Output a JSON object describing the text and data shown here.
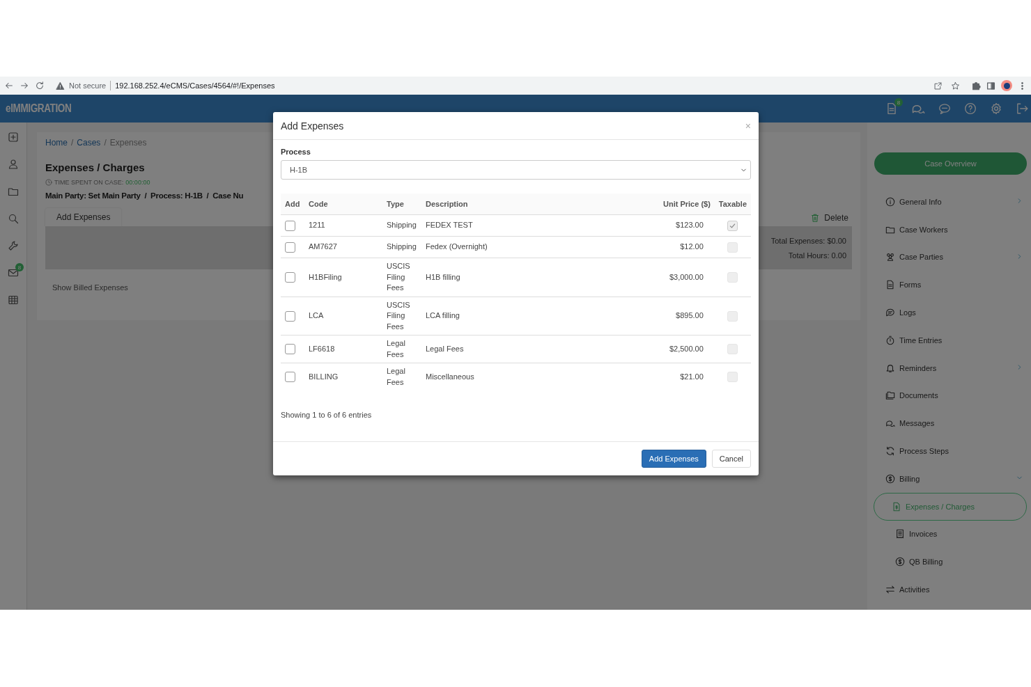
{
  "browser": {
    "security": "Not secure",
    "url": "192.168.252.4/eCMS/Cases/4564/#!/Expenses"
  },
  "header": {
    "logo": "eIMMIGRATION",
    "notification_badge": "8"
  },
  "rail": {
    "mail_badge": "8"
  },
  "breadcrumb": {
    "separator": "/",
    "items": [
      "Home",
      "Cases",
      "Expenses"
    ]
  },
  "page": {
    "title": "Expenses / Charges",
    "time_label": "TIME SPENT ON CASE:",
    "time_value": "00:00:00",
    "info": "Main Party: Set Main Party  /  Process: H-1B  /  Case Nu",
    "tab": "Add Expenses",
    "delete": "Delete",
    "total_expenses": "Total Expenses: $0.00",
    "total_hours": "Total Hours: 0.00",
    "show_billed": "Show Billed Expenses"
  },
  "sidebar": {
    "overview_button": "Case Overview",
    "items": [
      {
        "label": "General Info",
        "kind": "group",
        "expanded": false
      },
      {
        "label": "Case Workers",
        "kind": "link"
      },
      {
        "label": "Case Parties",
        "kind": "group",
        "expanded": false
      },
      {
        "label": "Forms",
        "kind": "link"
      },
      {
        "label": "Logs",
        "kind": "link"
      },
      {
        "label": "Time Entries",
        "kind": "link"
      },
      {
        "label": "Reminders",
        "kind": "group",
        "expanded": false
      },
      {
        "label": "Documents",
        "kind": "link"
      },
      {
        "label": "Messages",
        "kind": "link"
      },
      {
        "label": "Process Steps",
        "kind": "link"
      },
      {
        "label": "Billing",
        "kind": "group",
        "expanded": true,
        "children": [
          {
            "label": "Expenses / Charges",
            "selected": true
          },
          {
            "label": "Invoices",
            "selected": false
          },
          {
            "label": "QB Billing",
            "selected": false
          }
        ]
      },
      {
        "label": "Activities",
        "kind": "link"
      }
    ]
  },
  "modal": {
    "title": "Add Expenses",
    "close": "×",
    "process_label": "Process",
    "process_value": "H-1B",
    "columns": [
      "Add",
      "Code",
      "Type",
      "Description",
      "Unit Price ($)",
      "Taxable"
    ],
    "rows": [
      {
        "add": false,
        "code": "1211",
        "type": "Shipping",
        "description": "FEDEX TEST",
        "price": "$123.00",
        "taxable": true
      },
      {
        "add": false,
        "code": "AM7627",
        "type": "Shipping",
        "description": "Fedex (Overnight)",
        "price": "$12.00",
        "taxable": false
      },
      {
        "add": false,
        "code": "H1BFiling",
        "type": "USCIS Filing Fees",
        "description": "H1B filling",
        "price": "$3,000.00",
        "taxable": false
      },
      {
        "add": false,
        "code": "LCA",
        "type": "USCIS Filing Fees",
        "description": "LCA filling",
        "price": "$895.00",
        "taxable": false
      },
      {
        "add": false,
        "code": "LF6618",
        "type": "Legal Fees",
        "description": "Legal Fees",
        "price": "$2,500.00",
        "taxable": false
      },
      {
        "add": false,
        "code": "BILLING",
        "type": "Legal Fees",
        "description": "Miscellaneous",
        "price": "$21.00",
        "taxable": false
      }
    ],
    "footer_info": "Showing 1 to 6 of 6 entries",
    "buttons": [
      "Add Expenses",
      "Cancel"
    ]
  }
}
